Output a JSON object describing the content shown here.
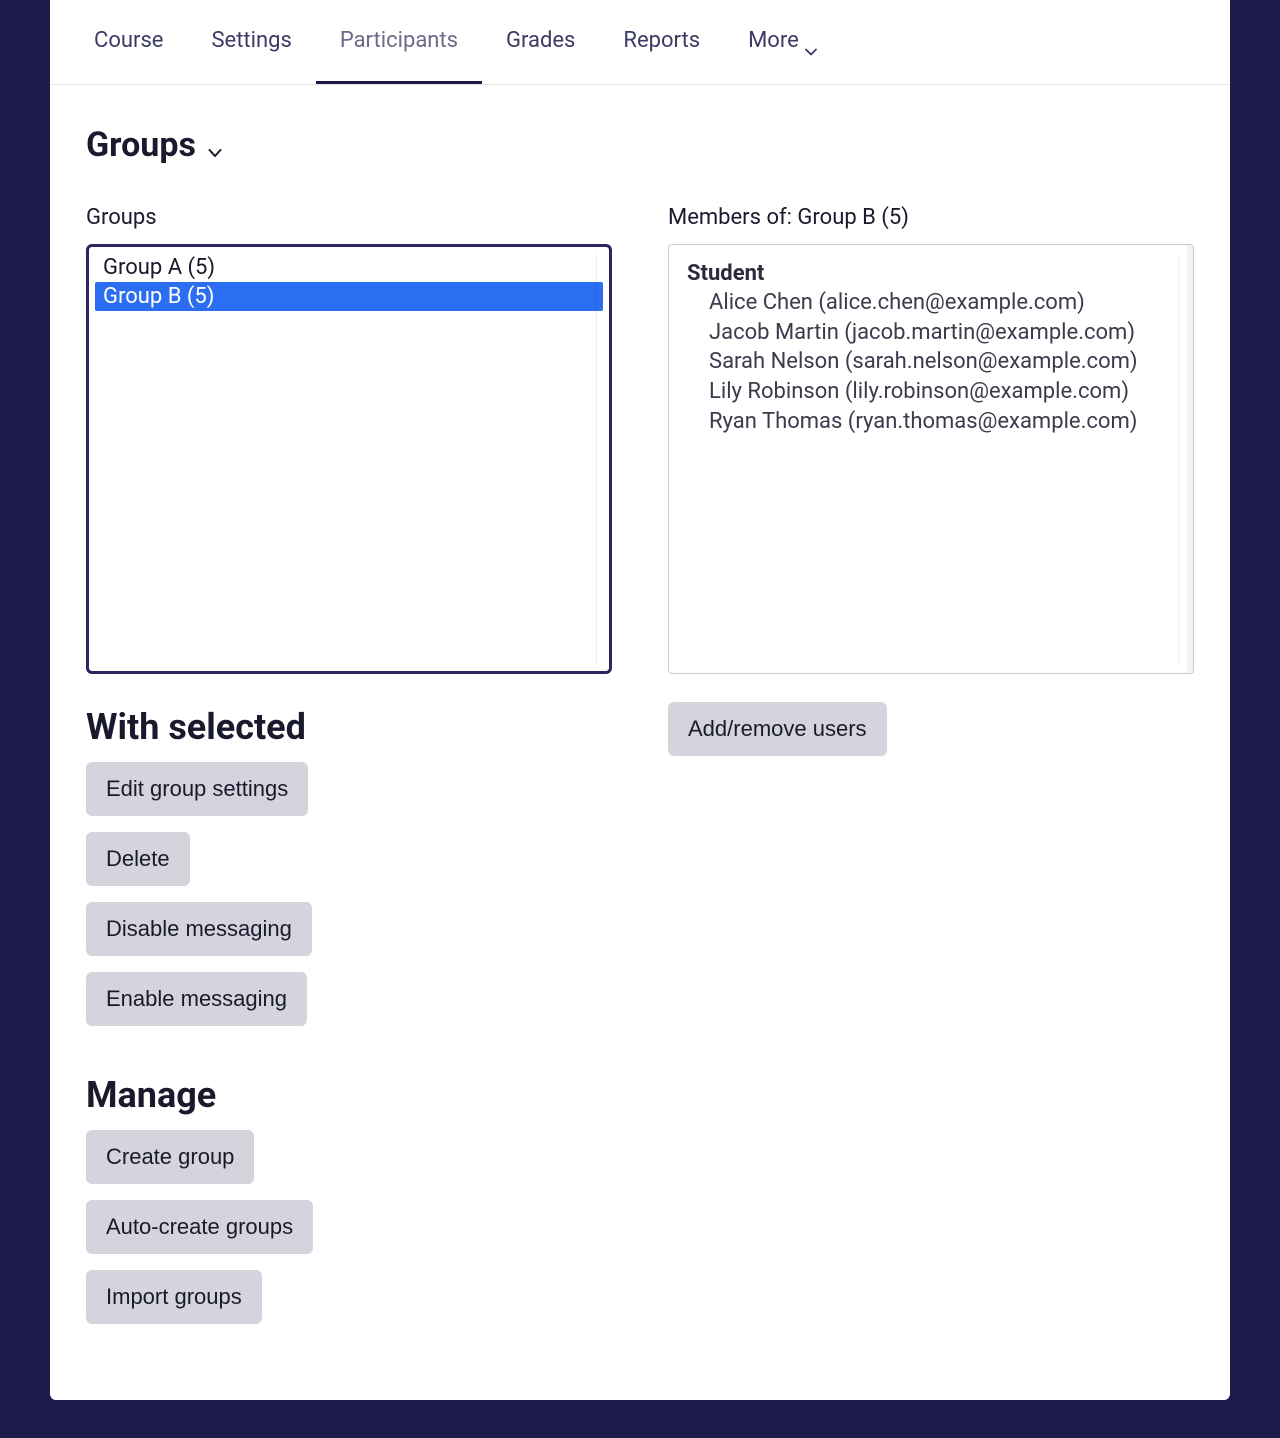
{
  "nav": {
    "tabs": [
      "Course",
      "Settings",
      "Participants",
      "Grades",
      "Reports"
    ],
    "more_label": "More",
    "active_index": 2
  },
  "page": {
    "title": "Groups"
  },
  "groups_panel": {
    "label": "Groups",
    "items": [
      {
        "label": "Group A (5)",
        "selected": false
      },
      {
        "label": "Group B (5)",
        "selected": true
      }
    ]
  },
  "members_panel": {
    "label": "Members of: Group B (5)",
    "role_heading": "Student",
    "members": [
      "Alice Chen (alice.chen@example.com)",
      "Jacob Martin (jacob.martin@example.com)",
      "Sarah Nelson (sarah.nelson@example.com)",
      "Lily Robinson (lily.robinson@example.com)",
      "Ryan Thomas (ryan.thomas@example.com)"
    ]
  },
  "with_selected": {
    "heading": "With selected",
    "buttons": {
      "edit": "Edit group settings",
      "delete": "Delete",
      "disable_msg": "Disable messaging",
      "enable_msg": "Enable messaging"
    }
  },
  "manage": {
    "heading": "Manage",
    "buttons": {
      "create": "Create group",
      "auto_create": "Auto-create groups",
      "import": "Import groups"
    }
  },
  "members_actions": {
    "add_remove": "Add/remove users"
  }
}
